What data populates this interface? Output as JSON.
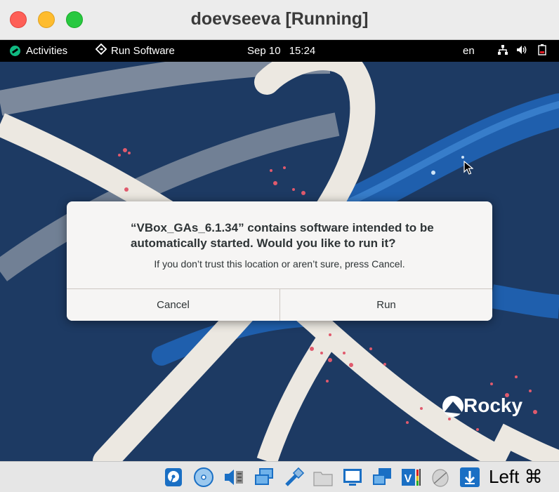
{
  "window": {
    "title": "doevseeva [Running]"
  },
  "topbar": {
    "activities": "Activities",
    "app_name": "Run Software",
    "date": "Sep 10",
    "time": "15:24",
    "language": "en",
    "icons": [
      "network-icon",
      "volume-icon",
      "battery-icon"
    ]
  },
  "wallpaper": {
    "brand": "Rocky",
    "background_color": "#1d3a63"
  },
  "dialog": {
    "title": "“VBox_GAs_6.1.34” contains software intended to be automatically started. Would you like to run it?",
    "message": "If you don’t trust this location or aren’t sure, press Cancel.",
    "cancel_label": "Cancel",
    "run_label": "Run"
  },
  "statusbar": {
    "icons": [
      "hard-disk-icon",
      "optical-drive-icon",
      "audio-icon",
      "network-adapter-icon",
      "usb-icon",
      "shared-folders-icon",
      "display-icon",
      "video-capture-icon",
      "cpu-activity-icon",
      "mouse-integration-icon",
      "keyboard-capture-icon"
    ],
    "host_key": "Left ⌘"
  },
  "colors": {
    "close": "#fe5f57",
    "minimize": "#febc2e",
    "maximize": "#28c840",
    "desktop": "#1d3a63"
  }
}
